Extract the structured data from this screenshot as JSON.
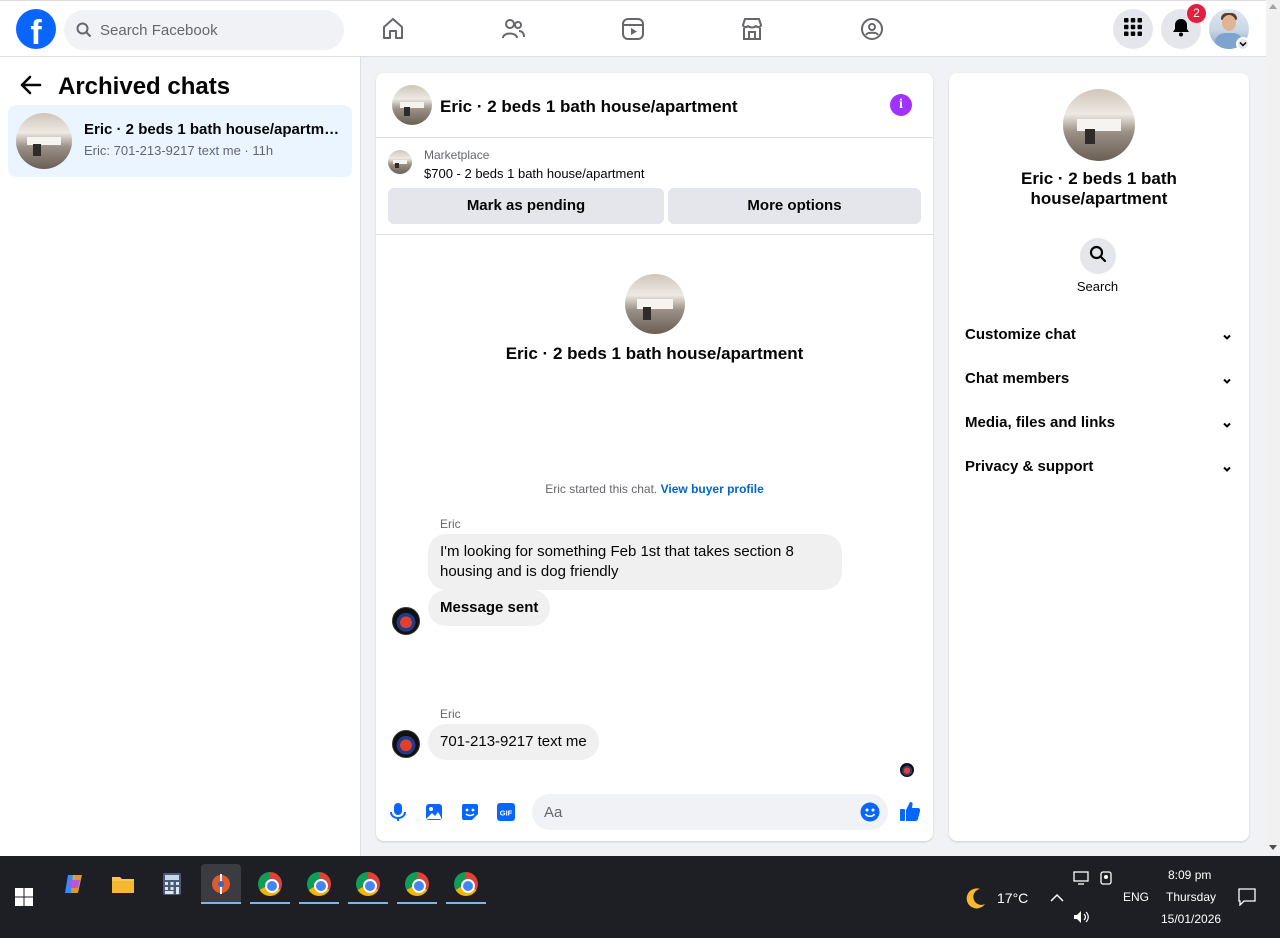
{
  "topnav": {
    "logo": "f",
    "search_placeholder": "Search Facebook",
    "notification_count": "2",
    "nav_icons": [
      "home-icon",
      "friends-icon",
      "video-icon",
      "marketplace-icon",
      "groups-icon"
    ]
  },
  "sidebar": {
    "title": "Archived chats",
    "threads": [
      {
        "name": "Eric · 2 beds 1 bath house/apartment",
        "snippet": "Eric: 701-213-9217 text me · 11h"
      }
    ]
  },
  "chat": {
    "title": "Eric · 2 beds 1 bath house/apartment",
    "marketplace": {
      "label": "Marketplace",
      "price_title": "$700 - 2 beds 1 bath house/apartment",
      "mark_pending": "Mark as pending",
      "more_options": "More options"
    },
    "center_name": "Eric · 2 beds 1 bath house/apartment",
    "started_text": "Eric started this chat.",
    "buyer_profile_link": "View buyer profile",
    "groups": [
      {
        "sender": "Eric",
        "messages": [
          "I'm looking for something Feb 1st that takes section 8 housing and is dog friendly"
        ],
        "system": "Message sent"
      },
      {
        "sender": "Eric",
        "messages": [
          "701-213-9217 text me"
        ]
      }
    ],
    "composer_placeholder": "Aa"
  },
  "info": {
    "name": "Eric · 2 beds 1 bath house/apartment",
    "search_label": "Search",
    "sections": [
      "Customize chat",
      "Chat members",
      "Media, files and links",
      "Privacy & support"
    ]
  },
  "taskbar": {
    "weather": "17°C",
    "language": "ENG",
    "time": "8:09 pm",
    "day": "Thursday",
    "date": "15/01/2026"
  },
  "colors": {
    "brand": "#0866ff",
    "messenger_accent": "#a033ff",
    "selected_thread": "#ebf5ff",
    "notification_badge": "#e41e3f"
  }
}
